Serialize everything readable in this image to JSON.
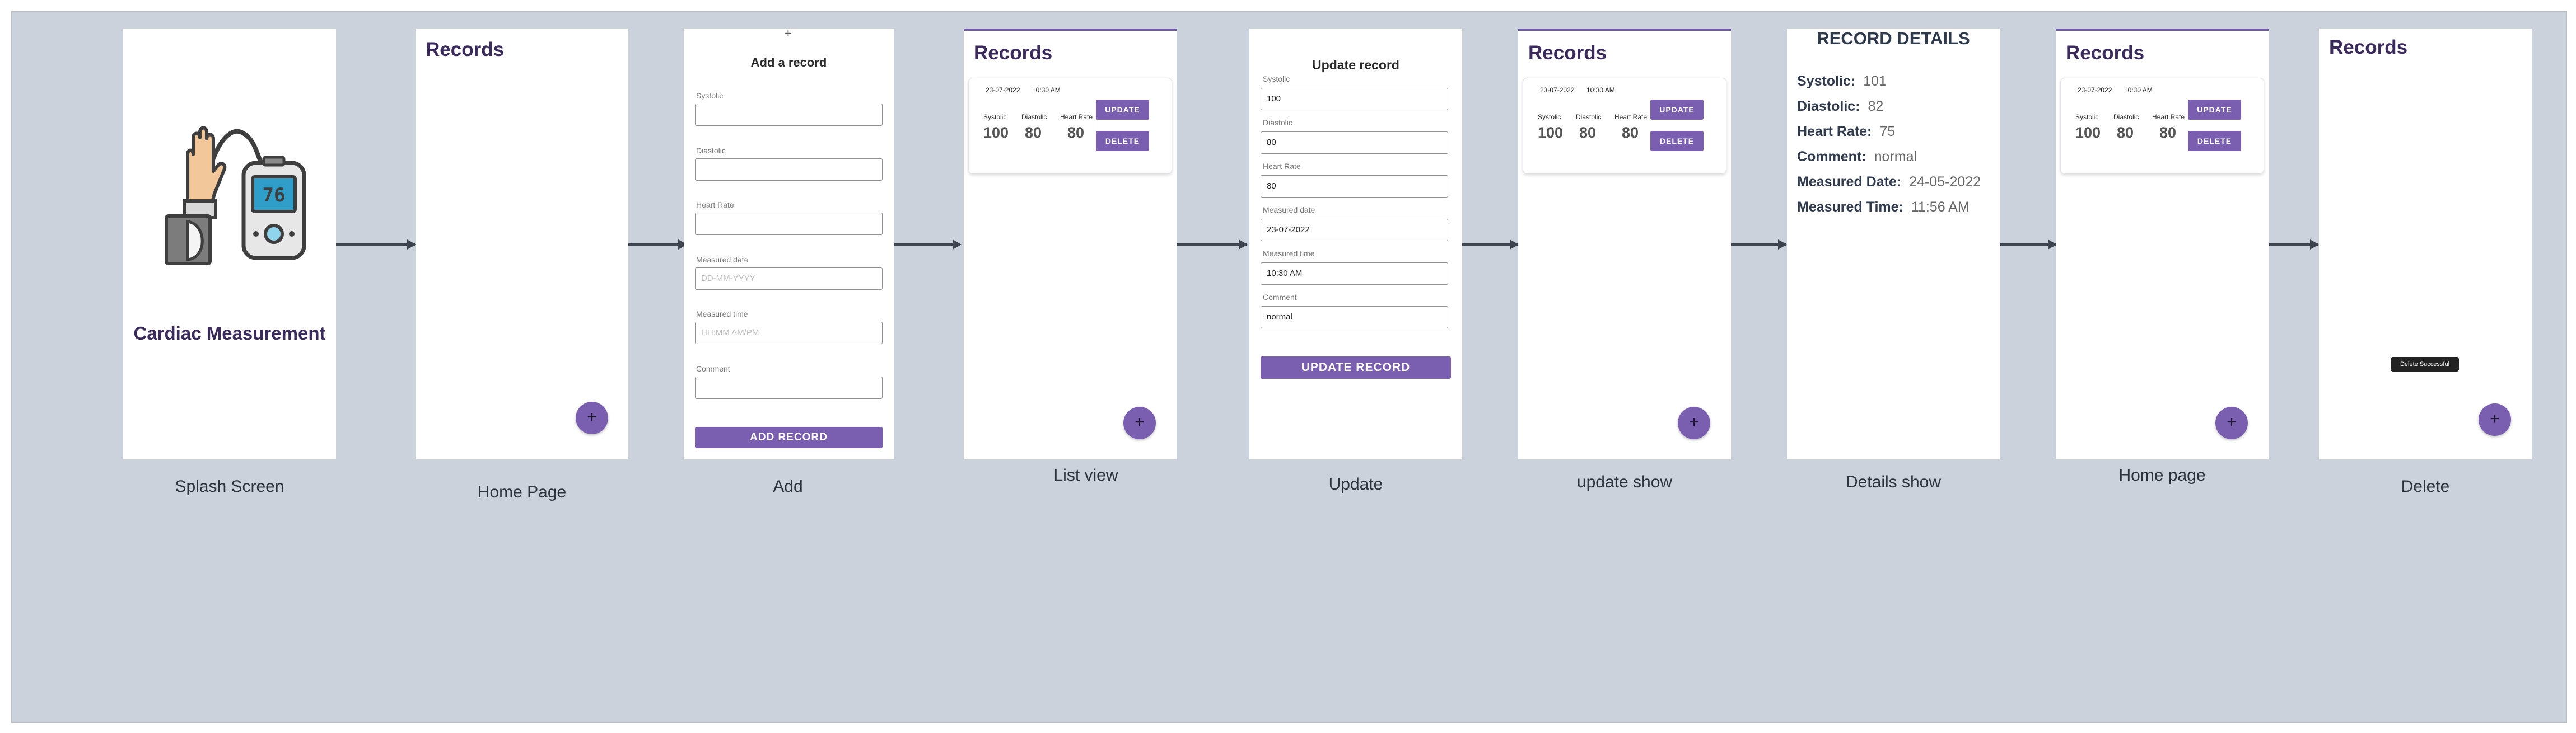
{
  "captions": {
    "splash": "Splash Screen",
    "home": "Home Page",
    "add": "Add",
    "list": "List view",
    "update": "Update",
    "update_show": "update show",
    "details": "Details show",
    "home2": "Home page",
    "delete": "Delete"
  },
  "splash": {
    "title": "Cardiac Measurement",
    "device_reading": "76"
  },
  "records_title": "Records",
  "fab_label": "+",
  "add": {
    "top_plus": "+",
    "title": "Add a record",
    "labels": [
      "Systolic",
      "Diastolic",
      "Heart Rate",
      "Measured date",
      "Measured time",
      "Comment"
    ],
    "placeholders": [
      "",
      "",
      "",
      "DD-MM-YYYY",
      "HH:MM AM/PM",
      ""
    ],
    "button": "ADD RECORD"
  },
  "record": {
    "date": "23-07-2022",
    "time": "10:30 AM",
    "systolic_label": "Systolic",
    "diastolic_label": "Diastolic",
    "heart_rate_label": "Heart Rate",
    "systolic": "100",
    "diastolic": "80",
    "heart_rate": "80",
    "update_button": "UPDATE",
    "delete_button": "DELETE"
  },
  "update": {
    "title": "Update record",
    "labels": [
      "Systolic",
      "Diastolic",
      "Heart Rate",
      "Measured date",
      "Measured time",
      "Comment"
    ],
    "values": [
      "100",
      "80",
      "80",
      "23-07-2022",
      "10:30 AM",
      "normal"
    ],
    "button": "UPDATE RECORD"
  },
  "details": {
    "title": "RECORD DETAILS",
    "rows": [
      {
        "label": "Systolic:",
        "value": "101"
      },
      {
        "label": "Diastolic:",
        "value": "82"
      },
      {
        "label": "Heart Rate:",
        "value": "75"
      },
      {
        "label": "Comment:",
        "value": "normal"
      },
      {
        "label": "Measured Date:",
        "value": "24-05-2022"
      },
      {
        "label": "Measured Time:",
        "value": "11:56 AM"
      }
    ]
  },
  "delete": {
    "toast": "Delete Successful"
  },
  "colors": {
    "accent": "#7a5fb1",
    "title": "#3b2a5c",
    "canvas": "#cbd2db"
  }
}
